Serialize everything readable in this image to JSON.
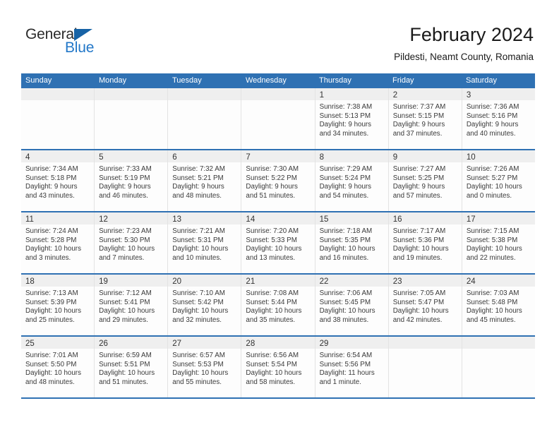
{
  "brand": {
    "name_part1": "General",
    "name_part2": "Blue",
    "triangle_color": "#1763a6",
    "blue_color": "#2277c8"
  },
  "header": {
    "title": "February 2024",
    "subtitle": "Pildesti, Neamt County, Romania"
  },
  "theme": {
    "accent": "#2f71b3",
    "day_band": "#efefef",
    "cell_bg": "#fdfdfd",
    "text": "#3a3a3a"
  },
  "weekdays": [
    "Sunday",
    "Monday",
    "Tuesday",
    "Wednesday",
    "Thursday",
    "Friday",
    "Saturday"
  ],
  "weeks": [
    [
      {
        "day": "",
        "sunrise": "",
        "sunset": "",
        "daylight1": "",
        "daylight2": ""
      },
      {
        "day": "",
        "sunrise": "",
        "sunset": "",
        "daylight1": "",
        "daylight2": ""
      },
      {
        "day": "",
        "sunrise": "",
        "sunset": "",
        "daylight1": "",
        "daylight2": ""
      },
      {
        "day": "",
        "sunrise": "",
        "sunset": "",
        "daylight1": "",
        "daylight2": ""
      },
      {
        "day": "1",
        "sunrise": "Sunrise: 7:38 AM",
        "sunset": "Sunset: 5:13 PM",
        "daylight1": "Daylight: 9 hours",
        "daylight2": "and 34 minutes."
      },
      {
        "day": "2",
        "sunrise": "Sunrise: 7:37 AM",
        "sunset": "Sunset: 5:15 PM",
        "daylight1": "Daylight: 9 hours",
        "daylight2": "and 37 minutes."
      },
      {
        "day": "3",
        "sunrise": "Sunrise: 7:36 AM",
        "sunset": "Sunset: 5:16 PM",
        "daylight1": "Daylight: 9 hours",
        "daylight2": "and 40 minutes."
      }
    ],
    [
      {
        "day": "4",
        "sunrise": "Sunrise: 7:34 AM",
        "sunset": "Sunset: 5:18 PM",
        "daylight1": "Daylight: 9 hours",
        "daylight2": "and 43 minutes."
      },
      {
        "day": "5",
        "sunrise": "Sunrise: 7:33 AM",
        "sunset": "Sunset: 5:19 PM",
        "daylight1": "Daylight: 9 hours",
        "daylight2": "and 46 minutes."
      },
      {
        "day": "6",
        "sunrise": "Sunrise: 7:32 AM",
        "sunset": "Sunset: 5:21 PM",
        "daylight1": "Daylight: 9 hours",
        "daylight2": "and 48 minutes."
      },
      {
        "day": "7",
        "sunrise": "Sunrise: 7:30 AM",
        "sunset": "Sunset: 5:22 PM",
        "daylight1": "Daylight: 9 hours",
        "daylight2": "and 51 minutes."
      },
      {
        "day": "8",
        "sunrise": "Sunrise: 7:29 AM",
        "sunset": "Sunset: 5:24 PM",
        "daylight1": "Daylight: 9 hours",
        "daylight2": "and 54 minutes."
      },
      {
        "day": "9",
        "sunrise": "Sunrise: 7:27 AM",
        "sunset": "Sunset: 5:25 PM",
        "daylight1": "Daylight: 9 hours",
        "daylight2": "and 57 minutes."
      },
      {
        "day": "10",
        "sunrise": "Sunrise: 7:26 AM",
        "sunset": "Sunset: 5:27 PM",
        "daylight1": "Daylight: 10 hours",
        "daylight2": "and 0 minutes."
      }
    ],
    [
      {
        "day": "11",
        "sunrise": "Sunrise: 7:24 AM",
        "sunset": "Sunset: 5:28 PM",
        "daylight1": "Daylight: 10 hours",
        "daylight2": "and 3 minutes."
      },
      {
        "day": "12",
        "sunrise": "Sunrise: 7:23 AM",
        "sunset": "Sunset: 5:30 PM",
        "daylight1": "Daylight: 10 hours",
        "daylight2": "and 7 minutes."
      },
      {
        "day": "13",
        "sunrise": "Sunrise: 7:21 AM",
        "sunset": "Sunset: 5:31 PM",
        "daylight1": "Daylight: 10 hours",
        "daylight2": "and 10 minutes."
      },
      {
        "day": "14",
        "sunrise": "Sunrise: 7:20 AM",
        "sunset": "Sunset: 5:33 PM",
        "daylight1": "Daylight: 10 hours",
        "daylight2": "and 13 minutes."
      },
      {
        "day": "15",
        "sunrise": "Sunrise: 7:18 AM",
        "sunset": "Sunset: 5:35 PM",
        "daylight1": "Daylight: 10 hours",
        "daylight2": "and 16 minutes."
      },
      {
        "day": "16",
        "sunrise": "Sunrise: 7:17 AM",
        "sunset": "Sunset: 5:36 PM",
        "daylight1": "Daylight: 10 hours",
        "daylight2": "and 19 minutes."
      },
      {
        "day": "17",
        "sunrise": "Sunrise: 7:15 AM",
        "sunset": "Sunset: 5:38 PM",
        "daylight1": "Daylight: 10 hours",
        "daylight2": "and 22 minutes."
      }
    ],
    [
      {
        "day": "18",
        "sunrise": "Sunrise: 7:13 AM",
        "sunset": "Sunset: 5:39 PM",
        "daylight1": "Daylight: 10 hours",
        "daylight2": "and 25 minutes."
      },
      {
        "day": "19",
        "sunrise": "Sunrise: 7:12 AM",
        "sunset": "Sunset: 5:41 PM",
        "daylight1": "Daylight: 10 hours",
        "daylight2": "and 29 minutes."
      },
      {
        "day": "20",
        "sunrise": "Sunrise: 7:10 AM",
        "sunset": "Sunset: 5:42 PM",
        "daylight1": "Daylight: 10 hours",
        "daylight2": "and 32 minutes."
      },
      {
        "day": "21",
        "sunrise": "Sunrise: 7:08 AM",
        "sunset": "Sunset: 5:44 PM",
        "daylight1": "Daylight: 10 hours",
        "daylight2": "and 35 minutes."
      },
      {
        "day": "22",
        "sunrise": "Sunrise: 7:06 AM",
        "sunset": "Sunset: 5:45 PM",
        "daylight1": "Daylight: 10 hours",
        "daylight2": "and 38 minutes."
      },
      {
        "day": "23",
        "sunrise": "Sunrise: 7:05 AM",
        "sunset": "Sunset: 5:47 PM",
        "daylight1": "Daylight: 10 hours",
        "daylight2": "and 42 minutes."
      },
      {
        "day": "24",
        "sunrise": "Sunrise: 7:03 AM",
        "sunset": "Sunset: 5:48 PM",
        "daylight1": "Daylight: 10 hours",
        "daylight2": "and 45 minutes."
      }
    ],
    [
      {
        "day": "25",
        "sunrise": "Sunrise: 7:01 AM",
        "sunset": "Sunset: 5:50 PM",
        "daylight1": "Daylight: 10 hours",
        "daylight2": "and 48 minutes."
      },
      {
        "day": "26",
        "sunrise": "Sunrise: 6:59 AM",
        "sunset": "Sunset: 5:51 PM",
        "daylight1": "Daylight: 10 hours",
        "daylight2": "and 51 minutes."
      },
      {
        "day": "27",
        "sunrise": "Sunrise: 6:57 AM",
        "sunset": "Sunset: 5:53 PM",
        "daylight1": "Daylight: 10 hours",
        "daylight2": "and 55 minutes."
      },
      {
        "day": "28",
        "sunrise": "Sunrise: 6:56 AM",
        "sunset": "Sunset: 5:54 PM",
        "daylight1": "Daylight: 10 hours",
        "daylight2": "and 58 minutes."
      },
      {
        "day": "29",
        "sunrise": "Sunrise: 6:54 AM",
        "sunset": "Sunset: 5:56 PM",
        "daylight1": "Daylight: 11 hours",
        "daylight2": "and 1 minute."
      },
      {
        "day": "",
        "sunrise": "",
        "sunset": "",
        "daylight1": "",
        "daylight2": ""
      },
      {
        "day": "",
        "sunrise": "",
        "sunset": "",
        "daylight1": "",
        "daylight2": ""
      }
    ]
  ]
}
